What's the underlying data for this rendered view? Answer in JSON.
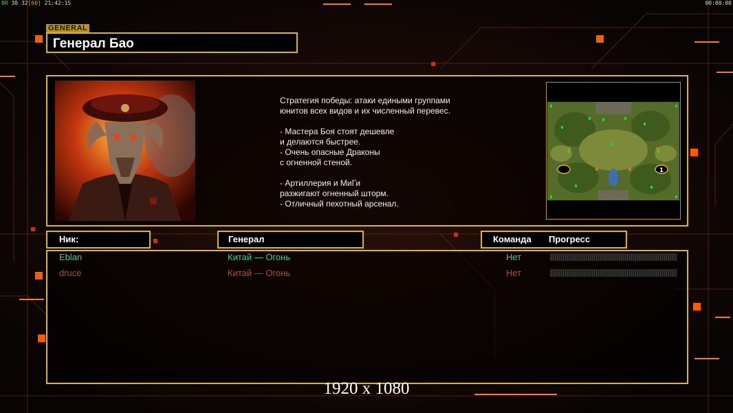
{
  "hud": {
    "top_left_prefix": "BR",
    "fps": "30",
    "frames": "32",
    "frame_cap": "[60]",
    "clock": "21:42:15",
    "top_right_timer": "00:00:00"
  },
  "section": {
    "tag": "GENERAL"
  },
  "general": {
    "name": "Генерал Бао",
    "strategy": "Стратегия победы: атаки едиными группами\nюнитов всех видов и их численный перевес.\n\n- Мастера Боя стоят дешевле\nи делаются быстрее.\n- Очень опасные Драконы\nс огненной стеной.\n\n- Артиллерия и МиГи\nразжигают огненный шторм.\n- Отличный пехотный арсенал."
  },
  "minimap": {
    "start_marker": "1"
  },
  "table": {
    "headers": {
      "nick": "Ник:",
      "general": "Генерал",
      "team": "Команда",
      "progress": "Прогресс"
    },
    "players": [
      {
        "nick": "Eblan",
        "general": "Китай — Огонь",
        "team": "Нет",
        "progress": 0,
        "color": "#2fd08a"
      },
      {
        "nick": "druce",
        "general": "Китай — Огонь",
        "team": "Нет",
        "progress": 0,
        "color": "#a4542e"
      }
    ]
  },
  "footer": {
    "resolution": "1920 x 1080"
  },
  "colors": {
    "frame": "#d8b62a",
    "tag_bg": "#b8951e",
    "accent_orange": "#ff5a00"
  }
}
